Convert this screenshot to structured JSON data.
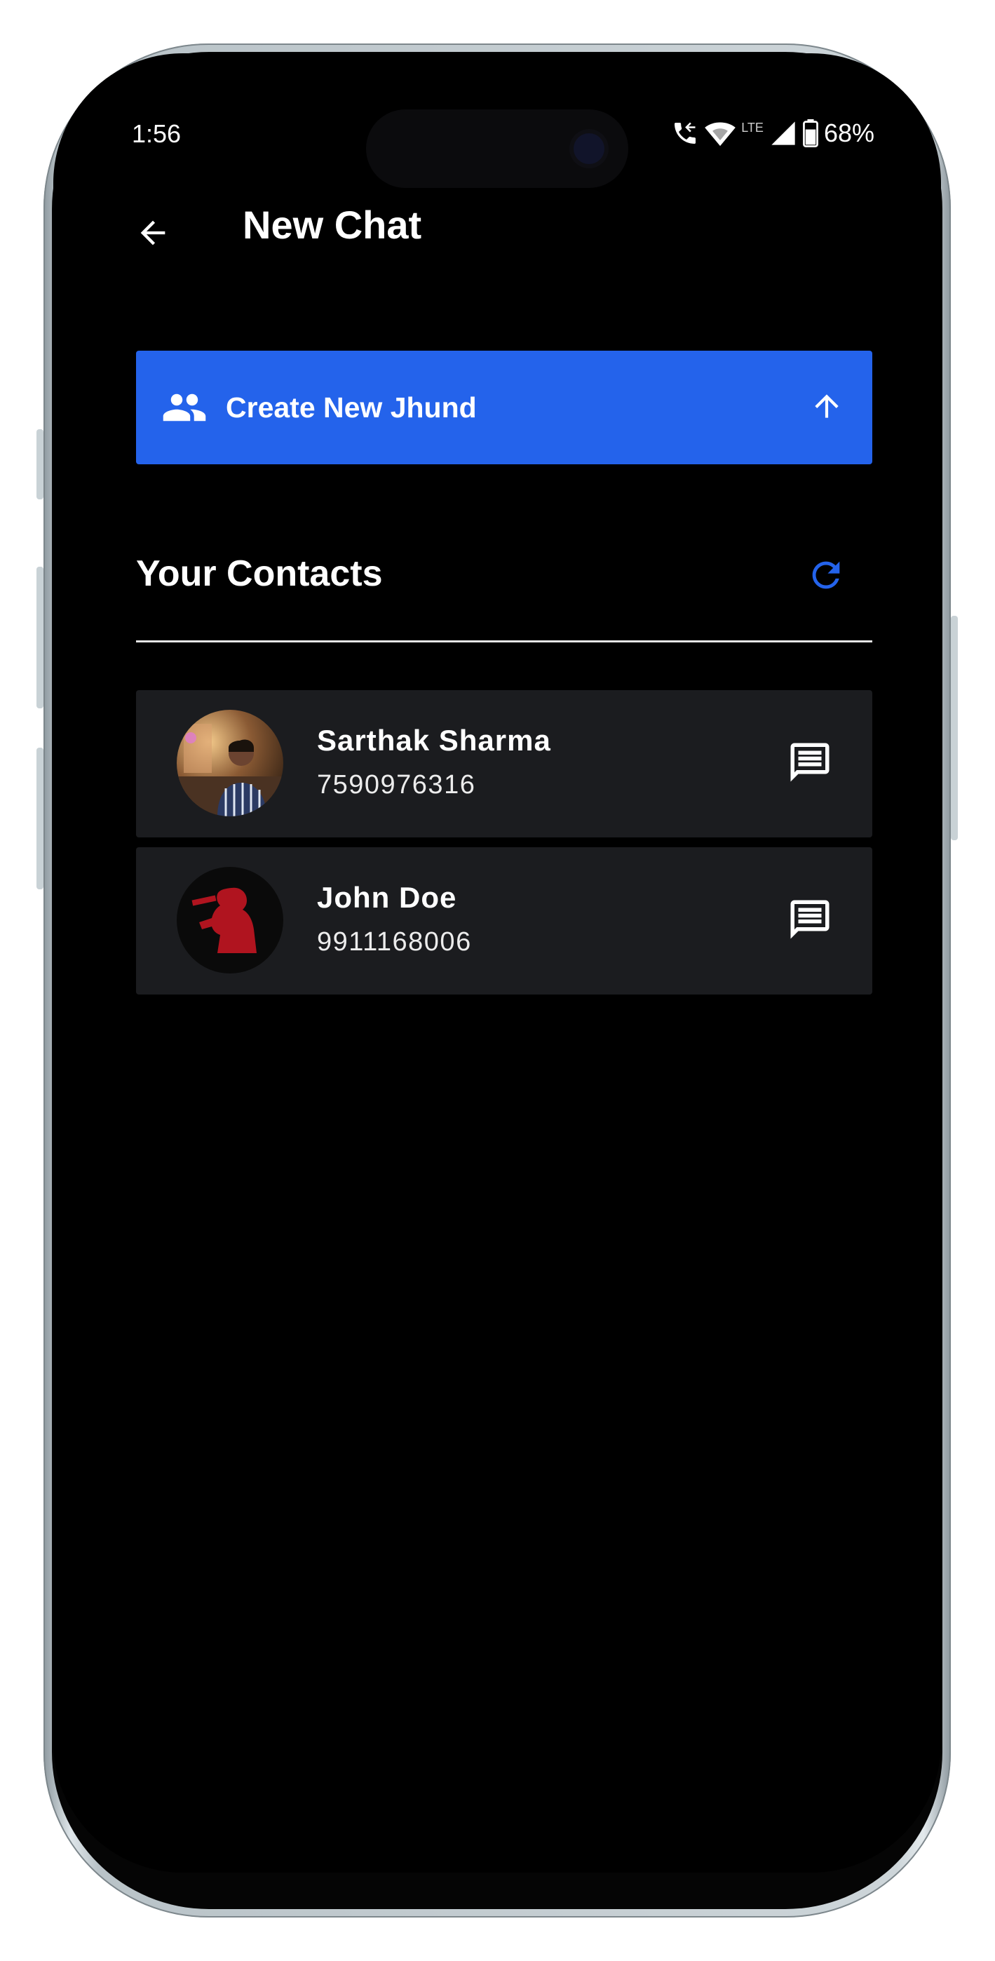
{
  "status_bar": {
    "time": "1:56",
    "network_label": "LTE",
    "battery_percent": "68%",
    "icons": [
      "wifi-calling-icon",
      "wifi-icon",
      "cell-signal-icon",
      "battery-icon"
    ]
  },
  "header": {
    "title": "New Chat",
    "back_icon": "arrow-left-icon"
  },
  "create_button": {
    "label": "Create New Jhund",
    "icon": "group-icon",
    "trailing_icon": "arrow-up-icon",
    "color": "#2463eb"
  },
  "contacts_section": {
    "title": "Your Contacts",
    "refresh_icon": "refresh-icon",
    "accent_color": "#2463eb"
  },
  "contacts": [
    {
      "name": "Sarthak Sharma",
      "phone": "7590976316",
      "avatar": "photo-avatar",
      "action_icon": "message-icon"
    },
    {
      "name": "John Doe",
      "phone": "9911168006",
      "avatar": "red-silhouette-avatar",
      "action_icon": "message-icon"
    }
  ]
}
